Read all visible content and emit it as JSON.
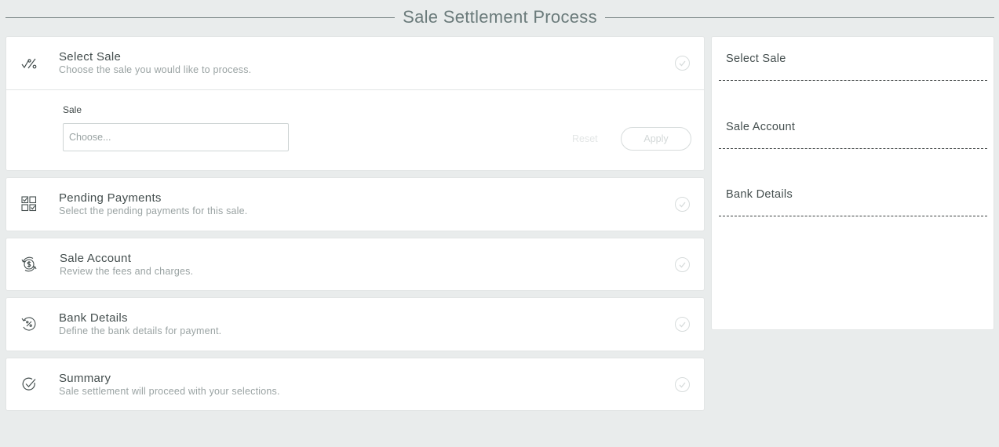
{
  "header": {
    "title": "Sale Settlement Process"
  },
  "steps": [
    {
      "title": "Select Sale",
      "subtitle": "Choose the sale you would like to process.",
      "icon": "percent-check-icon"
    },
    {
      "title": "Pending Payments",
      "subtitle": "Select the pending payments for this sale.",
      "icon": "checklist-grid-icon"
    },
    {
      "title": "Sale Account",
      "subtitle": "Review the fees and charges.",
      "icon": "dollar-cycle-icon"
    },
    {
      "title": "Bank Details",
      "subtitle": "Define the bank details for payment.",
      "icon": "percent-cycle-icon"
    },
    {
      "title": "Summary",
      "subtitle": "Sale settlement will proceed with your selections.",
      "icon": "check-circle-icon"
    }
  ],
  "sale_form": {
    "label": "Sale",
    "placeholder": "Choose...",
    "value": "",
    "reset_label": "Reset",
    "apply_label": "Apply"
  },
  "side_panel": {
    "sections": [
      {
        "label": "Select Sale"
      },
      {
        "label": "Sale Account"
      },
      {
        "label": "Bank Details"
      }
    ]
  },
  "colors": {
    "background": "#e9ecec",
    "card": "#ffffff",
    "title": "#6b7b7b",
    "muted": "#9aa3a3"
  }
}
